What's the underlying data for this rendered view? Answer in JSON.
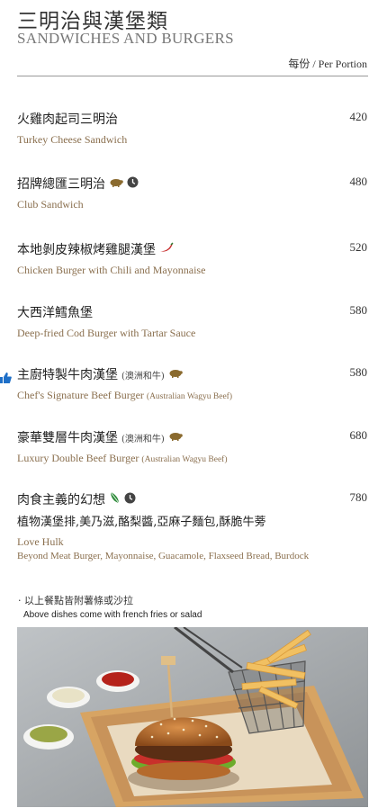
{
  "header": {
    "title_zh": "三明治與漢堡類",
    "title_en": "SANDWICHES AND BURGERS",
    "per_portion": "每份 / Per Portion"
  },
  "items": [
    {
      "zh": "火雞肉起司三明治",
      "en": "Turkey Cheese Sandwich",
      "price": "420"
    },
    {
      "zh": "招牌總匯三明治",
      "en": "Club Sandwich",
      "price": "480"
    },
    {
      "zh": "本地剝皮辣椒烤雞腿漢堡",
      "en": "Chicken Burger with Chili and Mayonnaise",
      "price": "520"
    },
    {
      "zh": "大西洋鱈魚堡",
      "en": "Deep-fried Cod Burger with Tartar Sauce",
      "price": "580"
    },
    {
      "zh": "主廚特製牛肉漢堡",
      "zh_note": "(澳洲和牛)",
      "en": "Chef's Signature Beef Burger",
      "en_note": "(Australian Wagyu Beef)",
      "price": "580"
    },
    {
      "zh": "豪華雙層牛肉漢堡",
      "zh_note": "(澳洲和牛)",
      "en": "Luxury Double Beef Burger",
      "en_note": "(Australian Wagyu Beef)",
      "price": "680"
    },
    {
      "zh": "肉食主義的幻想",
      "zh_desc": "植物漢堡排,美乃滋,酪梨醬,亞麻子麵包,酥脆牛蒡",
      "en": "Love Hulk",
      "en_desc": "Beyond Meat Burger, Mayonnaise, Guacamole, Flaxseed Bread, Burdock",
      "price": "780"
    }
  ],
  "note": {
    "zh": "以上餐點皆附薯條或沙拉",
    "en": "Above dishes come with french fries or salad"
  },
  "icons": {
    "pork": "pig-icon",
    "beef": "cow-icon",
    "clock": "clock-icon",
    "spicy": "chili-icon",
    "vegan": "leaf-icon",
    "recommended": "thumbs-up-icon"
  },
  "colors": {
    "accent_text": "#8a6f4e",
    "chili": "#c62828",
    "leaf": "#2e8b3a",
    "thumb": "#1e6fc8"
  }
}
